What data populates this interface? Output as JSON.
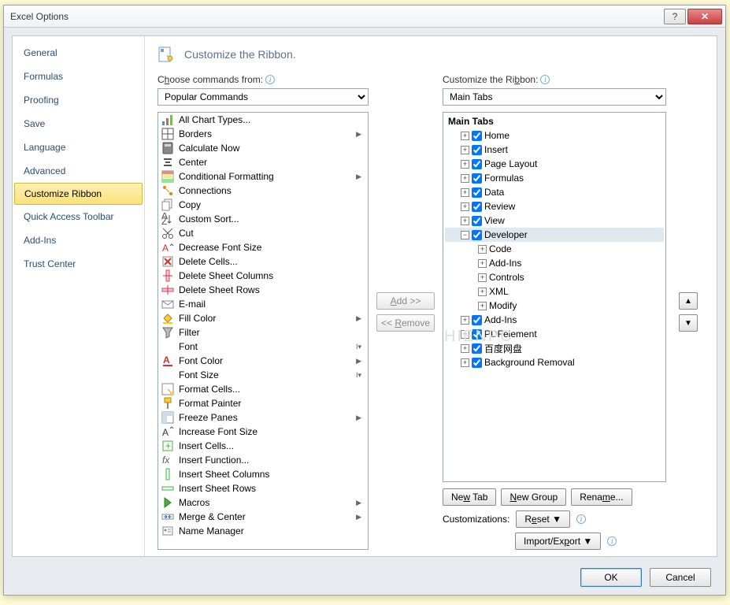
{
  "title": "Excel Options",
  "sidebar": {
    "items": [
      {
        "label": "General"
      },
      {
        "label": "Formulas"
      },
      {
        "label": "Proofing"
      },
      {
        "label": "Save"
      },
      {
        "label": "Language"
      },
      {
        "label": "Advanced"
      },
      {
        "label": "Customize Ribbon"
      },
      {
        "label": "Quick Access Toolbar"
      },
      {
        "label": "Add-Ins"
      },
      {
        "label": "Trust Center"
      }
    ],
    "selected": "Customize Ribbon"
  },
  "header": "Customize the Ribbon.",
  "left": {
    "label_pre": "C",
    "label_u": "h",
    "label_post": "oose commands from:",
    "combo": "Popular Commands",
    "commands": [
      {
        "name": "All Chart Types...",
        "icon": "chart-icon",
        "submenu": false
      },
      {
        "name": "Borders",
        "icon": "borders-icon",
        "submenu": true
      },
      {
        "name": "Calculate Now",
        "icon": "calc-icon",
        "submenu": false
      },
      {
        "name": "Center",
        "icon": "center-icon",
        "submenu": false
      },
      {
        "name": "Conditional Formatting",
        "icon": "condfmt-icon",
        "submenu": true
      },
      {
        "name": "Connections",
        "icon": "connections-icon",
        "submenu": false
      },
      {
        "name": "Copy",
        "icon": "copy-icon",
        "submenu": false
      },
      {
        "name": "Custom Sort...",
        "icon": "sort-icon",
        "submenu": false
      },
      {
        "name": "Cut",
        "icon": "cut-icon",
        "submenu": false
      },
      {
        "name": "Decrease Font Size",
        "icon": "fontdec-icon",
        "submenu": false
      },
      {
        "name": "Delete Cells...",
        "icon": "delcells-icon",
        "submenu": false
      },
      {
        "name": "Delete Sheet Columns",
        "icon": "delcols-icon",
        "submenu": false
      },
      {
        "name": "Delete Sheet Rows",
        "icon": "delrows-icon",
        "submenu": false
      },
      {
        "name": "E-mail",
        "icon": "email-icon",
        "submenu": false
      },
      {
        "name": "Fill Color",
        "icon": "fillcolor-icon",
        "submenu": true
      },
      {
        "name": "Filter",
        "icon": "filter-icon",
        "submenu": false
      },
      {
        "name": "Font",
        "icon": "font-icon",
        "submenu": true,
        "combo": true
      },
      {
        "name": "Font Color",
        "icon": "fontcolor-icon",
        "submenu": true
      },
      {
        "name": "Font Size",
        "icon": "fontsize-icon",
        "submenu": true,
        "combo": true
      },
      {
        "name": "Format Cells...",
        "icon": "fmtcells-icon",
        "submenu": false
      },
      {
        "name": "Format Painter",
        "icon": "painter-icon",
        "submenu": false
      },
      {
        "name": "Freeze Panes",
        "icon": "freeze-icon",
        "submenu": true
      },
      {
        "name": "Increase Font Size",
        "icon": "fontinc-icon",
        "submenu": false
      },
      {
        "name": "Insert Cells...",
        "icon": "inscells-icon",
        "submenu": false
      },
      {
        "name": "Insert Function...",
        "icon": "insfn-icon",
        "submenu": false
      },
      {
        "name": "Insert Sheet Columns",
        "icon": "inscols-icon",
        "submenu": false
      },
      {
        "name": "Insert Sheet Rows",
        "icon": "insrows-icon",
        "submenu": false
      },
      {
        "name": "Macros",
        "icon": "macros-icon",
        "submenu": true
      },
      {
        "name": "Merge & Center",
        "icon": "merge-icon",
        "submenu": true
      },
      {
        "name": "Name Manager",
        "icon": "namemgr-icon",
        "submenu": false
      }
    ]
  },
  "mid": {
    "add": "Add >>",
    "remove": "<< Remove",
    "remove_u": "R"
  },
  "right": {
    "label_pre": "Customize the Ri",
    "label_u": "b",
    "label_post": "bon:",
    "combo": "Main Tabs",
    "tree_header": "Main Tabs",
    "tabs": [
      {
        "label": "Home",
        "checked": true,
        "expanded": false
      },
      {
        "label": "Insert",
        "checked": true,
        "expanded": false
      },
      {
        "label": "Page Layout",
        "checked": true,
        "expanded": false
      },
      {
        "label": "Formulas",
        "checked": true,
        "expanded": false
      },
      {
        "label": "Data",
        "checked": true,
        "expanded": false
      },
      {
        "label": "Review",
        "checked": true,
        "expanded": false
      },
      {
        "label": "View",
        "checked": true,
        "expanded": false
      },
      {
        "label": "Developer",
        "checked": true,
        "expanded": true,
        "selected": true,
        "children": [
          {
            "label": "Code"
          },
          {
            "label": "Add-Ins"
          },
          {
            "label": "Controls"
          },
          {
            "label": "XML"
          },
          {
            "label": "Modify"
          }
        ]
      },
      {
        "label": "Add-Ins",
        "checked": true,
        "expanded": false
      },
      {
        "label": "PDFelement",
        "checked": true,
        "expanded": false
      },
      {
        "label": "百度网盘",
        "checked": true,
        "expanded": false
      },
      {
        "label": "Background Removal",
        "checked": true,
        "expanded": false
      }
    ],
    "buttons": {
      "newtab_pre": "Ne",
      "newtab_u": "w",
      "newtab_post": " Tab",
      "newgroup_pre": "",
      "newgroup_u": "N",
      "newgroup_post": "ew Group",
      "rename_pre": "Rena",
      "rename_u": "m",
      "rename_post": "e..."
    },
    "customizations_label": "Customizations:",
    "reset_pre": "R",
    "reset_u": "e",
    "reset_post": "set ▼",
    "importexport_pre": "Import/Ex",
    "importexport_u": "p",
    "importexport_post": "ort ▼"
  },
  "dialog": {
    "ok": "OK",
    "cancel": "Cancel"
  },
  "watermark": "HIENPC"
}
